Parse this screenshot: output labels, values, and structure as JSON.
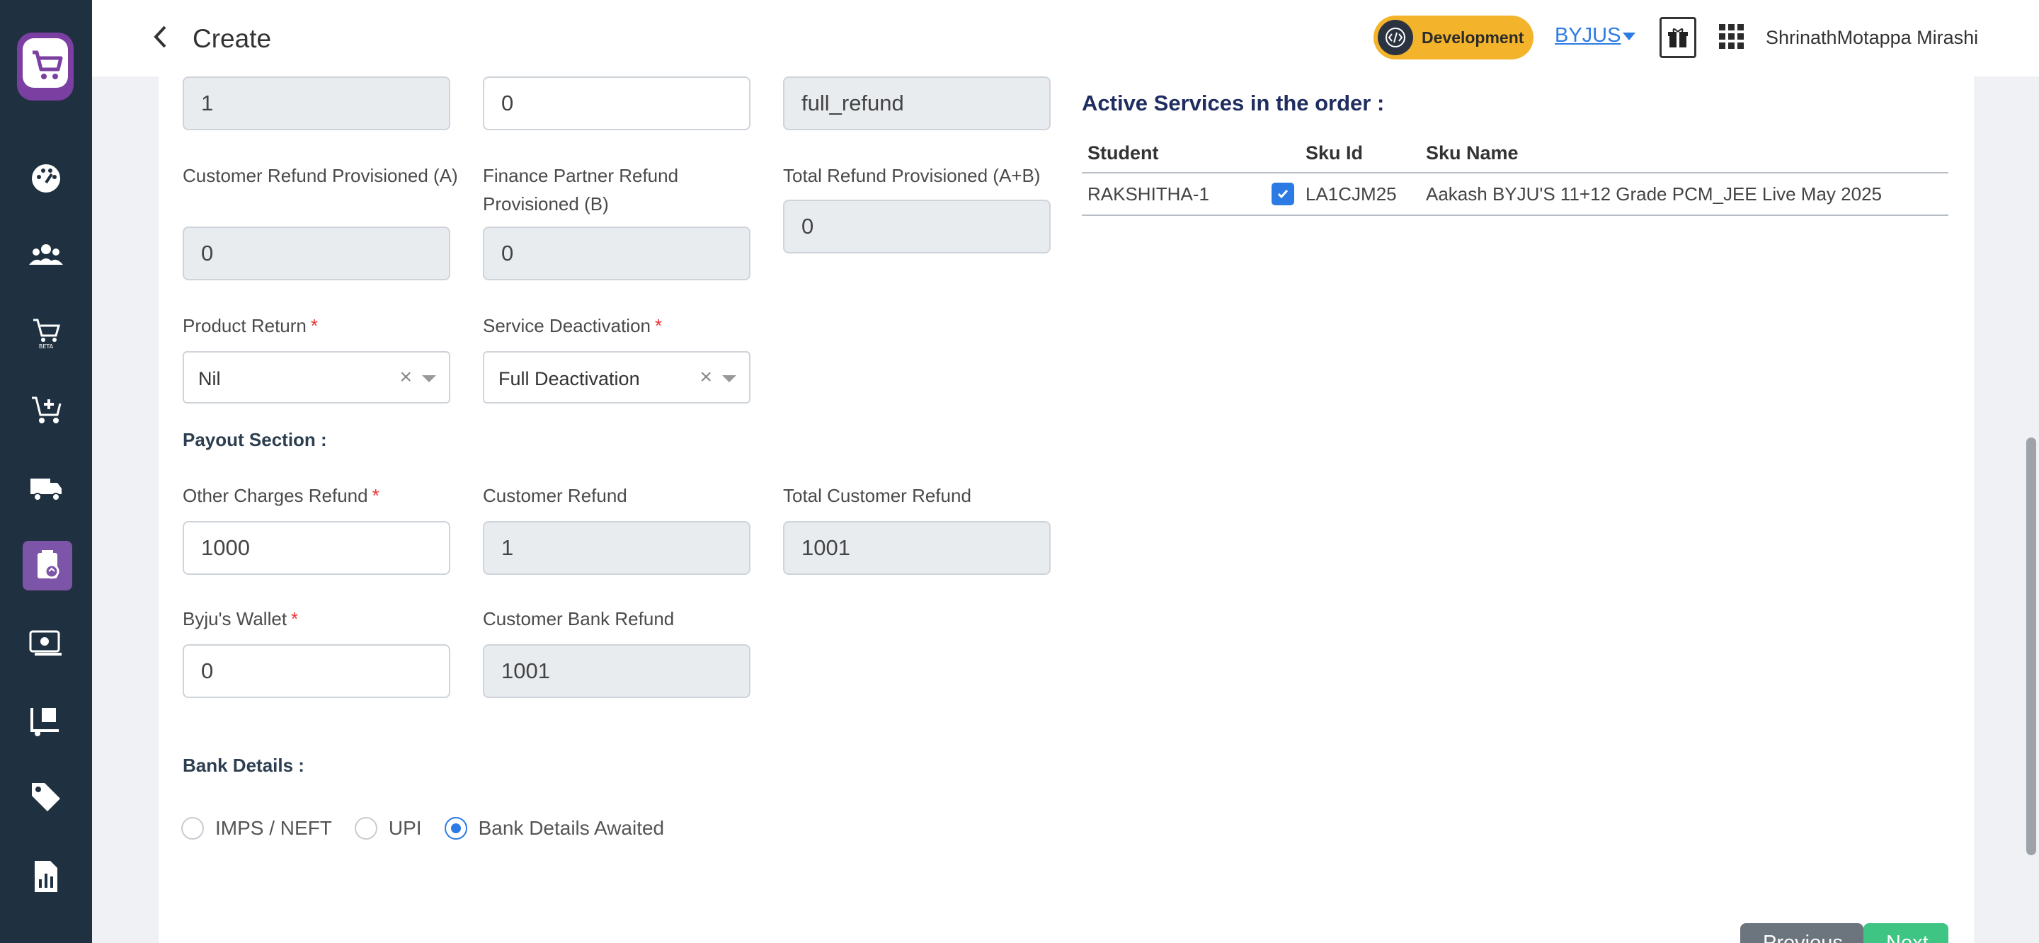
{
  "header": {
    "title": "Create",
    "env_badge": "Development",
    "org": "BYJUS",
    "user": "ShrinathMotappa Mirashi"
  },
  "sidebar": {
    "items": [
      {
        "icon": "dashboard-icon"
      },
      {
        "icon": "users-icon"
      },
      {
        "icon": "sales-beta-icon",
        "badge": "BETA"
      },
      {
        "icon": "add-to-cart-icon"
      },
      {
        "icon": "delivery-truck-icon"
      },
      {
        "icon": "refund-icon",
        "active": true
      },
      {
        "icon": "payments-icon"
      },
      {
        "icon": "warehouse-icon"
      },
      {
        "icon": "tag-icon"
      },
      {
        "icon": "reports-icon"
      }
    ]
  },
  "form": {
    "top_row": [
      "1",
      "0",
      "full_refund"
    ],
    "customer_refund_provisioned": {
      "label": "Customer Refund Provisioned (A)",
      "value": "0"
    },
    "finance_partner_refund_provisioned": {
      "label": "Finance Partner Refund Provisioned (B)",
      "value": "0"
    },
    "total_refund_provisioned": {
      "label": "Total Refund Provisioned (A+B)",
      "value": "0"
    },
    "product_return": {
      "label": "Product Return",
      "value": "Nil"
    },
    "service_deactivation": {
      "label": "Service Deactivation",
      "value": "Full Deactivation"
    },
    "payout_section_title": "Payout Section :",
    "other_charges_refund": {
      "label": "Other Charges Refund",
      "value": "1000"
    },
    "customer_refund": {
      "label": "Customer Refund",
      "value": "1"
    },
    "total_customer_refund": {
      "label": "Total Customer Refund",
      "value": "1001"
    },
    "byjus_wallet": {
      "label": "Byju's Wallet",
      "value": "0"
    },
    "customer_bank_refund": {
      "label": "Customer Bank Refund",
      "value": "1001"
    },
    "bank_details_title": "Bank Details :",
    "bank_options": [
      "IMPS / NEFT",
      "UPI",
      "Bank Details Awaited"
    ],
    "bank_selected": "Bank Details Awaited"
  },
  "active_services": {
    "title": "Active Services in the order :",
    "columns": [
      "Student",
      "",
      "Sku Id",
      "Sku Name"
    ],
    "rows": [
      {
        "student": "RAKSHITHA-1",
        "checked": true,
        "sku_id": "LA1CJM25",
        "sku_name": "Aakash BYJU'S 11+12 Grade PCM_JEE Live May 2025"
      }
    ]
  },
  "buttons": {
    "previous": "Previous",
    "next": "Next"
  },
  "colors": {
    "sidebar": "#1f3140",
    "accent": "#2c7be5",
    "badge": "#f3b32b"
  }
}
